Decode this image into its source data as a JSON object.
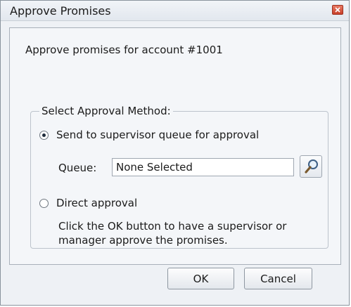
{
  "dialog": {
    "title": "Approve Promises",
    "prompt": "Approve promises for account #1001"
  },
  "approval_method": {
    "legend": "Select Approval Method:",
    "options": [
      {
        "label": "Send to supervisor queue for approval",
        "selected": true
      },
      {
        "label": "Direct approval",
        "selected": false
      }
    ],
    "queue_label": "Queue:",
    "queue_value": "None Selected",
    "direct_help": "Click the OK button to have a supervisor or manager approve the promises."
  },
  "buttons": {
    "ok": "OK",
    "cancel": "Cancel"
  },
  "icons": {
    "close": "close-icon",
    "lookup": "magnifier-icon"
  }
}
